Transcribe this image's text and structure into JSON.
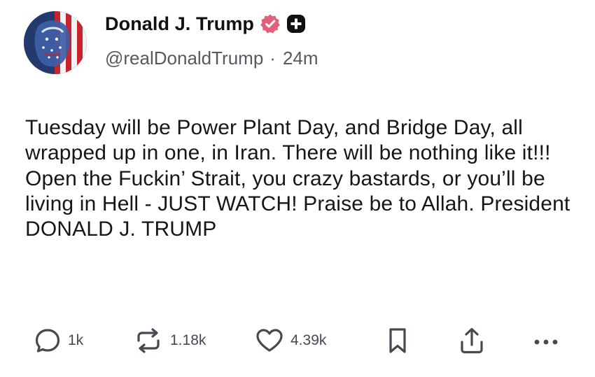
{
  "author": {
    "display_name": "Donald J. Trump",
    "handle": "@realDonaldTrump",
    "separator": "·",
    "time_ago": "24m",
    "verified_icon": "verified-badge-icon",
    "plus_icon": "plus-badge-icon",
    "accent_color": "#e0607e"
  },
  "post": {
    "text": "Tuesday will be Power Plant Day, and Bridge Day, all wrapped up in one, in Iran. There will be nothing like it!!! Open the Fuckin’ Strait, you crazy bastards, or you’ll be living in Hell - JUST WATCH! Praise be to Allah. President DONALD J. TRUMP"
  },
  "actions": {
    "reply_count": "1k",
    "repost_count": "1.18k",
    "like_count": "4.39k",
    "icons": [
      "reply-icon",
      "repost-icon",
      "like-icon",
      "bookmark-icon",
      "share-icon",
      "more-icon"
    ]
  }
}
